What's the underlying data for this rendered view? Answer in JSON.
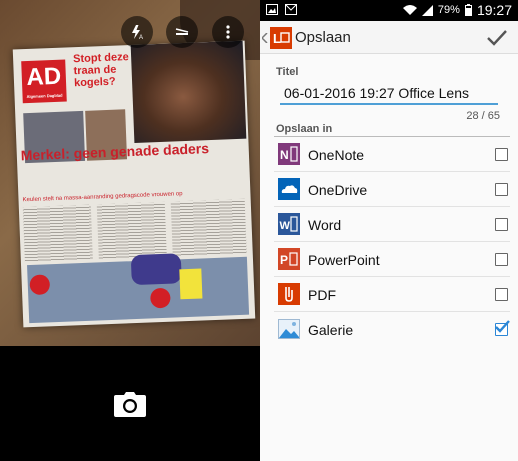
{
  "camera": {
    "newspaper": {
      "logo": "AD",
      "logo_sub": "Algemeen Dagblad",
      "teaser": "Stopt deze traan de kogels?",
      "headline_red": "Merkel: geen genade daders",
      "headline_black": "Merkel: geen genade daders",
      "subhead": "Keulen stelt na massa-aanranding gedragscode vrouwen op"
    },
    "toolbar": {
      "flash_icon": "flash-auto-icon",
      "mode_icon": "document-mode-icon",
      "more_icon": "more-vert-icon"
    },
    "shutter_icon": "camera-icon"
  },
  "status_bar": {
    "battery": "79%",
    "time": "19:27"
  },
  "action_bar": {
    "title": "Opslaan",
    "confirm_icon": "check-icon"
  },
  "form": {
    "title_label": "Titel",
    "title_value": "06-01-2016 19:27 Office Lens",
    "char_count": "28 / 65",
    "save_to_label": "Opslaan in"
  },
  "destinations": [
    {
      "label": "OneNote",
      "icon": "onenote-icon",
      "color": "#80397B",
      "checked": false
    },
    {
      "label": "OneDrive",
      "icon": "onedrive-icon",
      "color": "#0364B8",
      "checked": false
    },
    {
      "label": "Word",
      "icon": "word-icon",
      "color": "#2B579A",
      "checked": false
    },
    {
      "label": "PowerPoint",
      "icon": "powerpoint-icon",
      "color": "#D24726",
      "checked": false
    },
    {
      "label": "PDF",
      "icon": "pdf-icon",
      "color": "#D83B01",
      "checked": false
    },
    {
      "label": "Galerie",
      "icon": "gallery-icon",
      "color": "#2E8BD6",
      "checked": true
    }
  ]
}
